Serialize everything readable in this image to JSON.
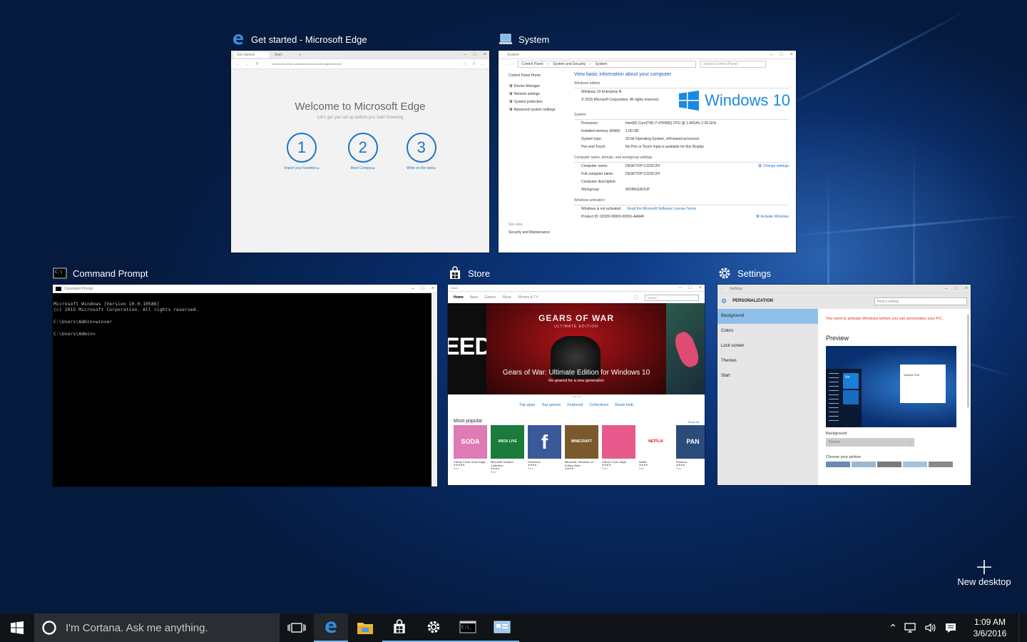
{
  "windows": {
    "edge": {
      "title": "Get started - Microsoft Edge",
      "tab_active": "Get started",
      "tab_second": "Start",
      "address": "microsoft.com/en-us/windows/microsoft-edge/welcome/",
      "heading": "Welcome to Microsoft Edge",
      "subheading": "Let's get you set up before you start browsing",
      "steps": [
        {
          "num": "1",
          "label": "Import your favorites ▸"
        },
        {
          "num": "2",
          "label": "Meet Cortana ▸"
        },
        {
          "num": "3",
          "label": "Write on the web ▸"
        }
      ]
    },
    "system": {
      "title": "System",
      "window_caption": "System",
      "breadcrumb": [
        "Control Panel",
        "System and Security",
        "System"
      ],
      "search_placeholder": "Search Control Panel",
      "left_links": [
        "Control Panel Home",
        "Device Manager",
        "Remote settings",
        "System protection",
        "Advanced system settings"
      ],
      "see_also": "See also",
      "see_also_link": "Security and Maintenance",
      "heading": "View basic information about your computer",
      "edition_section": "Windows edition",
      "edition": "Windows 10 Enterprise N",
      "copyright": "© 2015 Microsoft Corporation. All rights reserved.",
      "logo_text": "Windows 10",
      "system_section": "System",
      "system_rows": [
        {
          "k": "Processor:",
          "v": "Intel(R) Core(TM) i7-4700MQ CPU @ 2.40GHz   2.39 GHz"
        },
        {
          "k": "Installed memory (RAM):",
          "v": "1.00 GB"
        },
        {
          "k": "System type:",
          "v": "32-bit Operating System, x64-based processor"
        },
        {
          "k": "Pen and Touch:",
          "v": "No Pen or Touch Input is available for this Display"
        }
      ],
      "name_section": "Computer name, domain, and workgroup settings",
      "name_rows": [
        {
          "k": "Computer name:",
          "v": "DESKTOP-C22SC2H"
        },
        {
          "k": "Full computer name:",
          "v": "DESKTOP-C22SC2H"
        },
        {
          "k": "Computer description:",
          "v": ""
        },
        {
          "k": "Workgroup:",
          "v": "WORKGROUP"
        }
      ],
      "change_settings": "Change settings",
      "activation_section": "Windows activation",
      "activation_status": "Windows is not activated.",
      "license_link": "Read the Microsoft Software License Terms",
      "product_id": "Product ID: 00329-90000-00001-AA940",
      "activate_link": "Activate Windows"
    },
    "cmd": {
      "title": "Command Prompt",
      "window_caption": "Command Prompt",
      "lines": [
        "Microsoft Windows [Version 10.0.10586]",
        "(c) 2015 Microsoft Corporation. All rights reserved.",
        "",
        "C:\\Users\\Admin>winver",
        "",
        "C:\\Users\\Admin>"
      ]
    },
    "store": {
      "title": "Store",
      "window_caption": "Store",
      "nav": [
        "Home",
        "Apps",
        "Games",
        "Music",
        "Movies & TV"
      ],
      "search_placeholder": "Search",
      "hero_logo": "GEARS OF WAR",
      "hero_logo_sub": "ULTIMATE EDITION",
      "hero_left_text": "EED",
      "hero_title": "Gears of War: Ultimate Edition for Windows 10",
      "hero_subtitle": "Re-geared for a new generation",
      "links": [
        "Top apps",
        "Top games",
        "Featured",
        "Collections",
        "Deals Hub"
      ],
      "section": "Most popular",
      "show_all": "Show all",
      "tiles": [
        {
          "name": "Candy Crush Soda Saga",
          "rating": "★★★★★",
          "tile_text": "SODA",
          "color": "#e07ab5"
        },
        {
          "name": "Microsoft Solitaire Collection",
          "rating": "★★★★",
          "tile_text": "XBOX LIVE",
          "color": "#1a7b3a"
        },
        {
          "name": "Facebook",
          "rating": "★★★★",
          "tile_text": "f",
          "color": "#3b5998"
        },
        {
          "name": "Minecraft: Windows 10 Edition Beta",
          "rating": "★★★★",
          "tile_text": "MINECRAFT",
          "color": "#7a5a2c"
        },
        {
          "name": "Candy Crush Saga",
          "rating": "★★★★",
          "tile_text": "",
          "color": "#e85a8c"
        },
        {
          "name": "Netflix",
          "rating": "★★★★",
          "tile_text": "NETFLIX",
          "color": "#ffffff"
        },
        {
          "name": "Pandora",
          "rating": "★★★★",
          "tile_text": "PAN",
          "color": "#2b4b7a"
        }
      ],
      "tile_extra": [
        "Free",
        "Free",
        "Free",
        "",
        "Free*",
        "Free",
        "Free"
      ]
    },
    "settings": {
      "title": "Settings",
      "window_caption": "Settings",
      "section": "PERSONALIZATION",
      "search_placeholder": "Find a setting",
      "menu": [
        "Background",
        "Colors",
        "Lock screen",
        "Themes",
        "Start"
      ],
      "warning": "You need to activate Windows before you can personalize your PC.",
      "preview_label": "Preview",
      "sample_text": "Sample Text",
      "aa_text": "Aa",
      "background_label": "Background",
      "background_value": "Picture",
      "choose_label": "Choose your picture"
    }
  },
  "new_desktop": {
    "label": "New desktop",
    "icon": "plus-icon"
  },
  "taskbar": {
    "cortana_placeholder": "I'm Cortana. Ask me anything.",
    "time": "1:09 AM",
    "date": "3/6/2016",
    "icons": [
      "start-icon",
      "task-view-icon",
      "edge-icon",
      "file-explorer-icon",
      "store-icon",
      "settings-icon",
      "cmd-icon",
      "system-icon"
    ]
  },
  "colors": {
    "accent": "#1b74c7",
    "taskbar": "#101418",
    "cortana_box": "#2a2e33"
  }
}
